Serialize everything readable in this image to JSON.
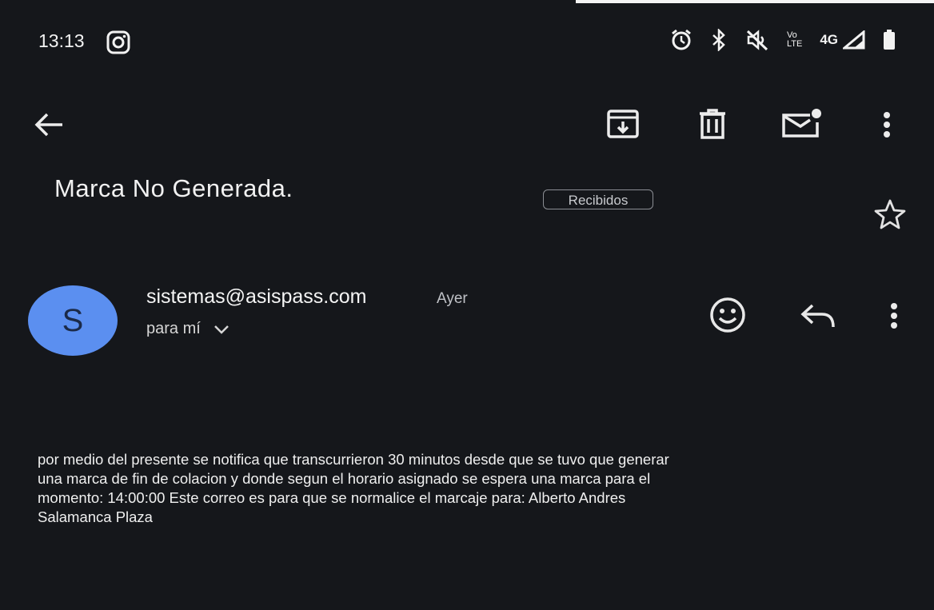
{
  "status_bar": {
    "time": "13:13",
    "network_label_top": "Vo",
    "network_label_bottom": "LTE",
    "network_type": "4G"
  },
  "toolbar": {
    "icons": [
      "back-arrow-icon",
      "archive-icon",
      "trash-icon",
      "mark-unread-icon",
      "more-vert-icon"
    ]
  },
  "email": {
    "subject": "Marca No Generada.",
    "label": "Recibidos",
    "sender_initial": "S",
    "sender": "sistemas@asispass.com",
    "date": "Ayer",
    "recipient": "para mí",
    "body_lines": [
      "por medio del presente se notifica que transcurrieron 30 minutos desde que se tuvo que generar",
      "una marca de fin  de colacion y donde segun el horario asignado se espera una marca para el",
      "momento:  14:00:00  Este correo es para que se normalice el marcaje para: Alberto Andres",
      "Salamanca Plaza"
    ]
  },
  "colors": {
    "background": "#15171b",
    "avatar": "#5b8ff0",
    "text": "#e6e6e6"
  }
}
